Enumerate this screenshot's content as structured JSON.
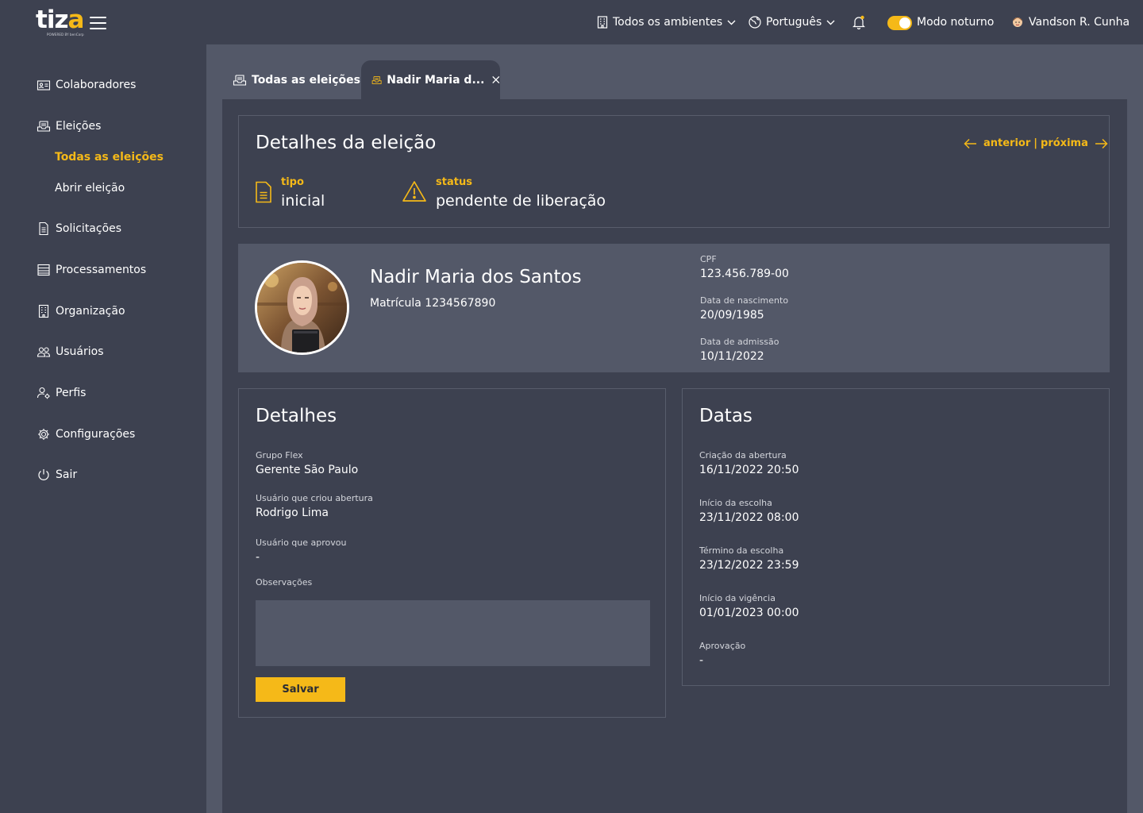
{
  "brand": {
    "logo_main": "tiz",
    "logo_accent": "a",
    "logo_tagline": "POWERED BY benCorp"
  },
  "header": {
    "environment": "Todos os ambientes",
    "language": "Português",
    "dark_mode_label": "Modo noturno",
    "dark_mode_on": true,
    "user_name": "Vandson R. Cunha"
  },
  "sidebar": {
    "items": [
      {
        "label": "Colaboradores",
        "icon": "id-card-icon"
      },
      {
        "label": "Eleições",
        "icon": "inbox-tray-icon"
      },
      {
        "label": "Solicitações",
        "icon": "document-icon"
      },
      {
        "label": "Processamentos",
        "icon": "list-icon"
      },
      {
        "label": "Organização",
        "icon": "building-icon"
      },
      {
        "label": "Usuários",
        "icon": "users-icon"
      },
      {
        "label": "Perfis",
        "icon": "user-gear-icon"
      },
      {
        "label": "Configurações",
        "icon": "gear-icon"
      },
      {
        "label": "Sair",
        "icon": "power-icon"
      }
    ],
    "sub_items": [
      {
        "label": "Todas as eleições",
        "active": true
      },
      {
        "label": "Abrir eleição",
        "active": false
      }
    ]
  },
  "tabs": [
    {
      "label": "Todas as eleições",
      "active": false
    },
    {
      "label": "Nadir Maria d...",
      "active": true
    }
  ],
  "election": {
    "title": "Detalhes da eleição",
    "prev_label": "anterior",
    "separator": "|",
    "next_label": "próxima",
    "type_label": "tipo",
    "type_value": "inicial",
    "status_label": "status",
    "status_value": "pendente de liberação"
  },
  "employee": {
    "name": "Nadir Maria dos Santos",
    "registration": "Matrícula 1234567890",
    "cpf_label": "CPF",
    "cpf": "123.456.789-00",
    "birth_label": "Data de nascimento",
    "birth": "20/09/1985",
    "admission_label": "Data de admissão",
    "admission": "10/11/2022"
  },
  "details": {
    "title": "Detalhes",
    "group_label": "Grupo Flex",
    "group": "Gerente São Paulo",
    "creator_label": "Usuário que criou abertura",
    "creator": "Rodrigo Lima",
    "approver_label": "Usuário que aprovou",
    "approver": "-",
    "notes_label": "Observações",
    "notes": "",
    "save_label": "Salvar"
  },
  "dates": {
    "title": "Datas",
    "items": [
      {
        "label": "Criação da abertura",
        "value": "16/11/2022 20:50"
      },
      {
        "label": "Início da escolha",
        "value": "23/11/2022 08:00"
      },
      {
        "label": "Término da escolha",
        "value": "23/12/2022 23:59"
      },
      {
        "label": "Início da vigência",
        "value": "01/01/2023 00:00"
      },
      {
        "label": "Aprovação",
        "value": "-"
      }
    ]
  },
  "colors": {
    "accent": "#f5b918",
    "background": "#3d4150",
    "surface": "#535868"
  }
}
